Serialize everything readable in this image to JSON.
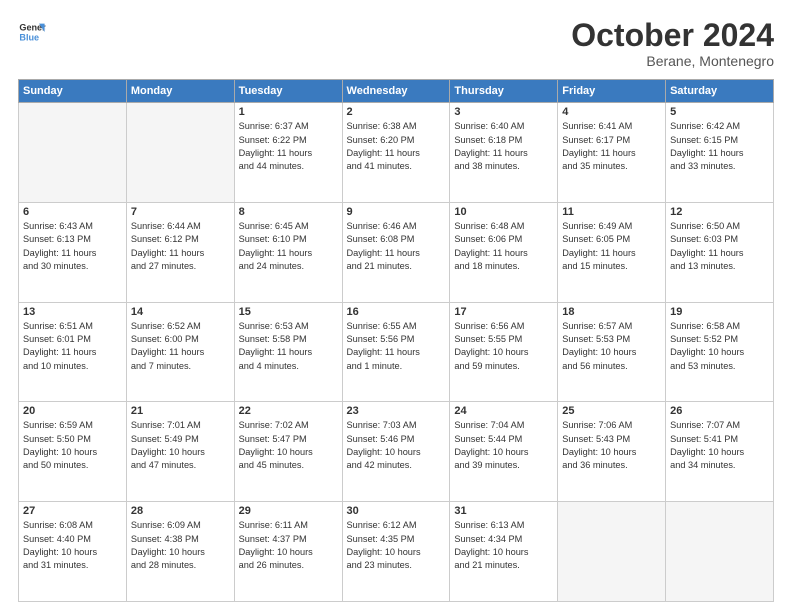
{
  "header": {
    "logo_line1": "General",
    "logo_line2": "Blue",
    "month": "October 2024",
    "location": "Berane, Montenegro"
  },
  "days_of_week": [
    "Sunday",
    "Monday",
    "Tuesday",
    "Wednesday",
    "Thursday",
    "Friday",
    "Saturday"
  ],
  "weeks": [
    [
      {
        "num": "",
        "info": ""
      },
      {
        "num": "",
        "info": ""
      },
      {
        "num": "1",
        "info": "Sunrise: 6:37 AM\nSunset: 6:22 PM\nDaylight: 11 hours\nand 44 minutes."
      },
      {
        "num": "2",
        "info": "Sunrise: 6:38 AM\nSunset: 6:20 PM\nDaylight: 11 hours\nand 41 minutes."
      },
      {
        "num": "3",
        "info": "Sunrise: 6:40 AM\nSunset: 6:18 PM\nDaylight: 11 hours\nand 38 minutes."
      },
      {
        "num": "4",
        "info": "Sunrise: 6:41 AM\nSunset: 6:17 PM\nDaylight: 11 hours\nand 35 minutes."
      },
      {
        "num": "5",
        "info": "Sunrise: 6:42 AM\nSunset: 6:15 PM\nDaylight: 11 hours\nand 33 minutes."
      }
    ],
    [
      {
        "num": "6",
        "info": "Sunrise: 6:43 AM\nSunset: 6:13 PM\nDaylight: 11 hours\nand 30 minutes."
      },
      {
        "num": "7",
        "info": "Sunrise: 6:44 AM\nSunset: 6:12 PM\nDaylight: 11 hours\nand 27 minutes."
      },
      {
        "num": "8",
        "info": "Sunrise: 6:45 AM\nSunset: 6:10 PM\nDaylight: 11 hours\nand 24 minutes."
      },
      {
        "num": "9",
        "info": "Sunrise: 6:46 AM\nSunset: 6:08 PM\nDaylight: 11 hours\nand 21 minutes."
      },
      {
        "num": "10",
        "info": "Sunrise: 6:48 AM\nSunset: 6:06 PM\nDaylight: 11 hours\nand 18 minutes."
      },
      {
        "num": "11",
        "info": "Sunrise: 6:49 AM\nSunset: 6:05 PM\nDaylight: 11 hours\nand 15 minutes."
      },
      {
        "num": "12",
        "info": "Sunrise: 6:50 AM\nSunset: 6:03 PM\nDaylight: 11 hours\nand 13 minutes."
      }
    ],
    [
      {
        "num": "13",
        "info": "Sunrise: 6:51 AM\nSunset: 6:01 PM\nDaylight: 11 hours\nand 10 minutes."
      },
      {
        "num": "14",
        "info": "Sunrise: 6:52 AM\nSunset: 6:00 PM\nDaylight: 11 hours\nand 7 minutes."
      },
      {
        "num": "15",
        "info": "Sunrise: 6:53 AM\nSunset: 5:58 PM\nDaylight: 11 hours\nand 4 minutes."
      },
      {
        "num": "16",
        "info": "Sunrise: 6:55 AM\nSunset: 5:56 PM\nDaylight: 11 hours\nand 1 minute."
      },
      {
        "num": "17",
        "info": "Sunrise: 6:56 AM\nSunset: 5:55 PM\nDaylight: 10 hours\nand 59 minutes."
      },
      {
        "num": "18",
        "info": "Sunrise: 6:57 AM\nSunset: 5:53 PM\nDaylight: 10 hours\nand 56 minutes."
      },
      {
        "num": "19",
        "info": "Sunrise: 6:58 AM\nSunset: 5:52 PM\nDaylight: 10 hours\nand 53 minutes."
      }
    ],
    [
      {
        "num": "20",
        "info": "Sunrise: 6:59 AM\nSunset: 5:50 PM\nDaylight: 10 hours\nand 50 minutes."
      },
      {
        "num": "21",
        "info": "Sunrise: 7:01 AM\nSunset: 5:49 PM\nDaylight: 10 hours\nand 47 minutes."
      },
      {
        "num": "22",
        "info": "Sunrise: 7:02 AM\nSunset: 5:47 PM\nDaylight: 10 hours\nand 45 minutes."
      },
      {
        "num": "23",
        "info": "Sunrise: 7:03 AM\nSunset: 5:46 PM\nDaylight: 10 hours\nand 42 minutes."
      },
      {
        "num": "24",
        "info": "Sunrise: 7:04 AM\nSunset: 5:44 PM\nDaylight: 10 hours\nand 39 minutes."
      },
      {
        "num": "25",
        "info": "Sunrise: 7:06 AM\nSunset: 5:43 PM\nDaylight: 10 hours\nand 36 minutes."
      },
      {
        "num": "26",
        "info": "Sunrise: 7:07 AM\nSunset: 5:41 PM\nDaylight: 10 hours\nand 34 minutes."
      }
    ],
    [
      {
        "num": "27",
        "info": "Sunrise: 6:08 AM\nSunset: 4:40 PM\nDaylight: 10 hours\nand 31 minutes."
      },
      {
        "num": "28",
        "info": "Sunrise: 6:09 AM\nSunset: 4:38 PM\nDaylight: 10 hours\nand 28 minutes."
      },
      {
        "num": "29",
        "info": "Sunrise: 6:11 AM\nSunset: 4:37 PM\nDaylight: 10 hours\nand 26 minutes."
      },
      {
        "num": "30",
        "info": "Sunrise: 6:12 AM\nSunset: 4:35 PM\nDaylight: 10 hours\nand 23 minutes."
      },
      {
        "num": "31",
        "info": "Sunrise: 6:13 AM\nSunset: 4:34 PM\nDaylight: 10 hours\nand 21 minutes."
      },
      {
        "num": "",
        "info": ""
      },
      {
        "num": "",
        "info": ""
      }
    ]
  ]
}
